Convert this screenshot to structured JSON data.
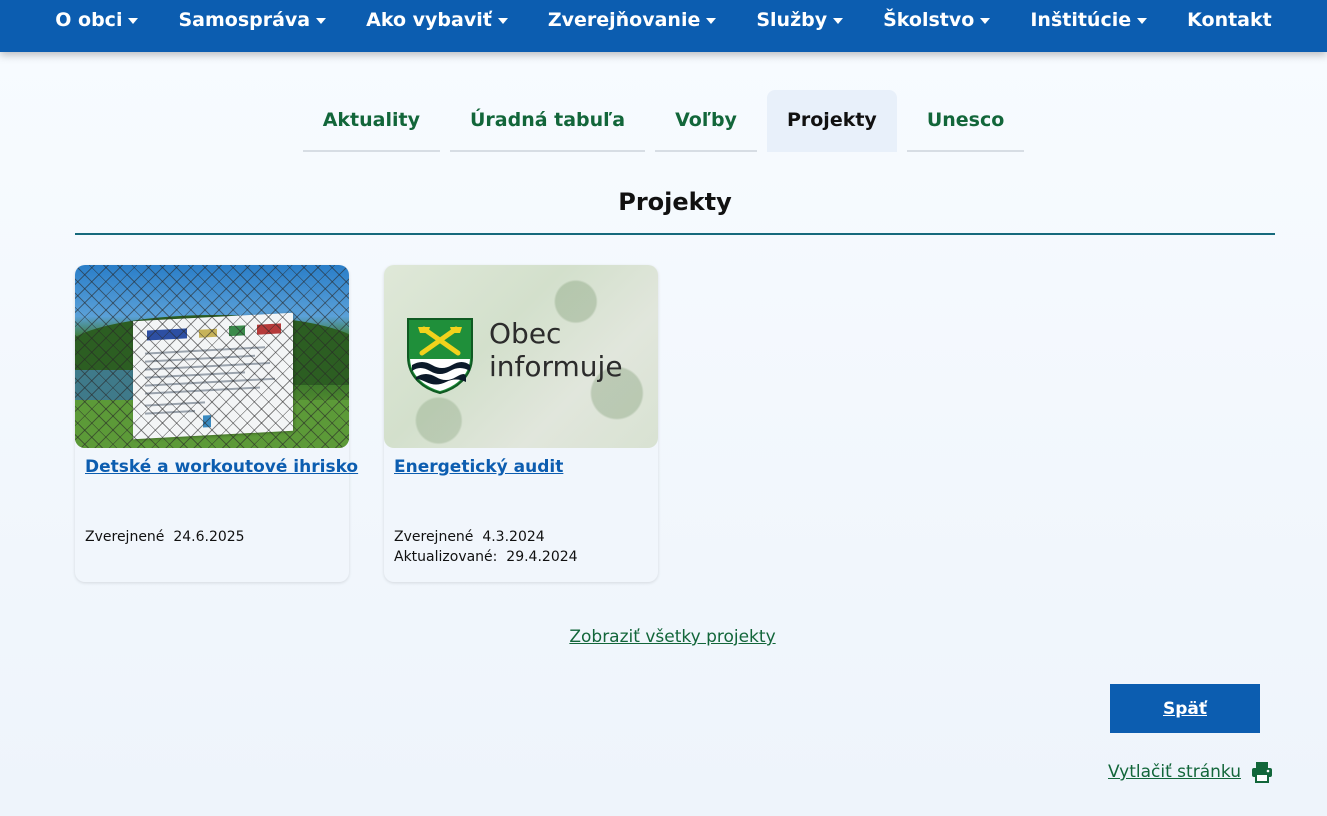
{
  "nav": {
    "items": [
      {
        "label": "O obci",
        "dropdown": true
      },
      {
        "label": "Samospráva",
        "dropdown": true
      },
      {
        "label": "Ako vybaviť",
        "dropdown": true
      },
      {
        "label": "Zverejňovanie",
        "dropdown": true
      },
      {
        "label": "Služby",
        "dropdown": true
      },
      {
        "label": "Školstvo",
        "dropdown": true
      },
      {
        "label": "Inštitúcie",
        "dropdown": true
      },
      {
        "label": "Kontakt",
        "dropdown": false
      }
    ]
  },
  "tabs": [
    {
      "label": "Aktuality",
      "active": false
    },
    {
      "label": "Úradná tabuľa",
      "active": false
    },
    {
      "label": "Voľby",
      "active": false
    },
    {
      "label": "Projekty",
      "active": true
    },
    {
      "label": "Unesco",
      "active": false
    }
  ],
  "section": {
    "title": "Projekty"
  },
  "cards": [
    {
      "title": "Detské a workoutové ihrisko",
      "published_label": "Zverejnené",
      "published": "24.6.2025"
    },
    {
      "title": "Energetický audit",
      "published_label": "Zverejnené",
      "published": "4.3.2024",
      "updated_label": "Aktualizované:",
      "updated": "29.4.2024",
      "thumb_text_line1": "Obec",
      "thumb_text_line2": "informuje"
    }
  ],
  "view_all_label": "Zobraziť všetky projekty",
  "back_label": "Späť",
  "print_label": "Vytlačiť stránku",
  "colors": {
    "nav_bg": "#0c5db0",
    "link_green": "#12663a",
    "link_blue": "#0c5db0",
    "divider": "#166a7c"
  }
}
